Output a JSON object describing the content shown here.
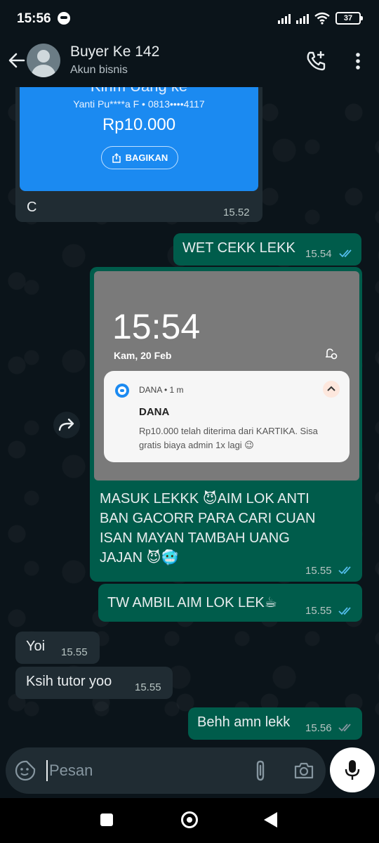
{
  "status_bar": {
    "time": "15:56",
    "battery": "37"
  },
  "header": {
    "contact_name": "Buyer Ke 142",
    "contact_subtitle": "Akun bisnis",
    "icons": [
      "back-arrow-icon",
      "avatar",
      "add-call-icon",
      "more-vert-icon"
    ]
  },
  "messages": [
    {
      "direction": "in",
      "type": "image",
      "image": {
        "title_cut": "Kirim Uang ke",
        "recipient": "Yanti Pu****a F • 0813••••4117",
        "amount": "Rp10.000",
        "share_label": "BAGIKAN"
      },
      "caption": "C",
      "time": "15.52"
    },
    {
      "direction": "out",
      "text": "WET CEKK LEKK",
      "time": "15.54",
      "status": "read"
    },
    {
      "direction": "out",
      "type": "image",
      "image": {
        "lock_time": "15:54",
        "lock_date": "Kam, 20 Feb",
        "notif_app": "DANA • 1 m",
        "notif_title": "DANA",
        "notif_body": "Rp10.000 telah diterima dari KARTIKA. Sisa gratis biaya admin 1x lagi 😉"
      },
      "caption": "MASUK LEKKK 😈AIM LOK ANTI\nBAN GACORR PARA CARI CUAN\nISAN MAYAN TAMBAH UANG\nJAJAN 😈🥶",
      "time": "15.55",
      "status": "read"
    },
    {
      "direction": "out",
      "text": "TW AMBIL AIM LOK LEK☕",
      "time": "15.55",
      "status": "read"
    },
    {
      "direction": "in",
      "text": "Yoi",
      "time": "15.55"
    },
    {
      "direction": "in",
      "text": "Ksih tutor yoo",
      "time": "15.55"
    },
    {
      "direction": "out",
      "text": "Behh amn lekk",
      "time": "15.56",
      "status": "delivered"
    }
  ],
  "composer": {
    "placeholder": "Pesan"
  },
  "colors": {
    "background": "#0b141a",
    "incoming_bubble": "#202c33",
    "outgoing_bubble": "#005c4b",
    "read_tick": "#53bdeb",
    "dana_blue": "#1b8af1"
  }
}
